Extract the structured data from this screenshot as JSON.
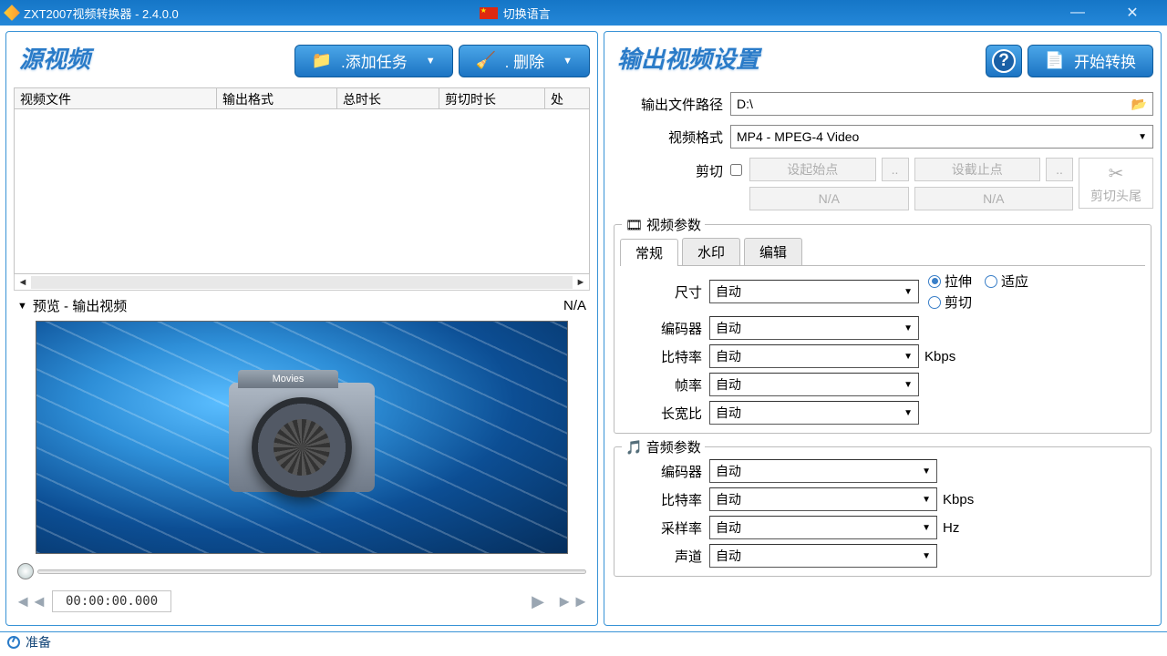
{
  "titlebar": {
    "appname": "ZXT2007视频转换器 - 2.4.0.0",
    "lang_switch": "切换语言"
  },
  "left": {
    "title": "源视频",
    "add_task": ".添加任务",
    "delete": ".  删除",
    "columns": {
      "file": "视频文件",
      "format": "输出格式",
      "duration": "总时长",
      "cut": "剪切时长",
      "process": "处"
    },
    "preview_label": "预览 - 输出视频",
    "preview_na": "N/A",
    "timecode": "00:00:00.000"
  },
  "right": {
    "title": "输出视频设置",
    "start": "开始转换",
    "out_path_lbl": "输出文件路径",
    "out_path": "D:\\",
    "format_lbl": "视频格式",
    "format": "MP4 - MPEG-4 Video",
    "cut_lbl": "剪切",
    "set_start": "设起始点",
    "set_end": "设截止点",
    "na": "N/A",
    "cut_head_tail": "剪切头尾",
    "video_params": "视频参数",
    "audio_params": "音频参数",
    "tabs": {
      "general": "常规",
      "watermark": "水印",
      "edit": "编辑"
    },
    "size_lbl": "尺寸",
    "encoder_lbl": "编码器",
    "bitrate_lbl": "比特率",
    "fps_lbl": "帧率",
    "aspect_lbl": "长宽比",
    "sample_lbl": "采样率",
    "channel_lbl": "声道",
    "auto": "自动",
    "kbps": "Kbps",
    "hz": "Hz",
    "stretch": "拉伸",
    "fit": "适应",
    "crop": "剪切"
  },
  "status": "准备"
}
